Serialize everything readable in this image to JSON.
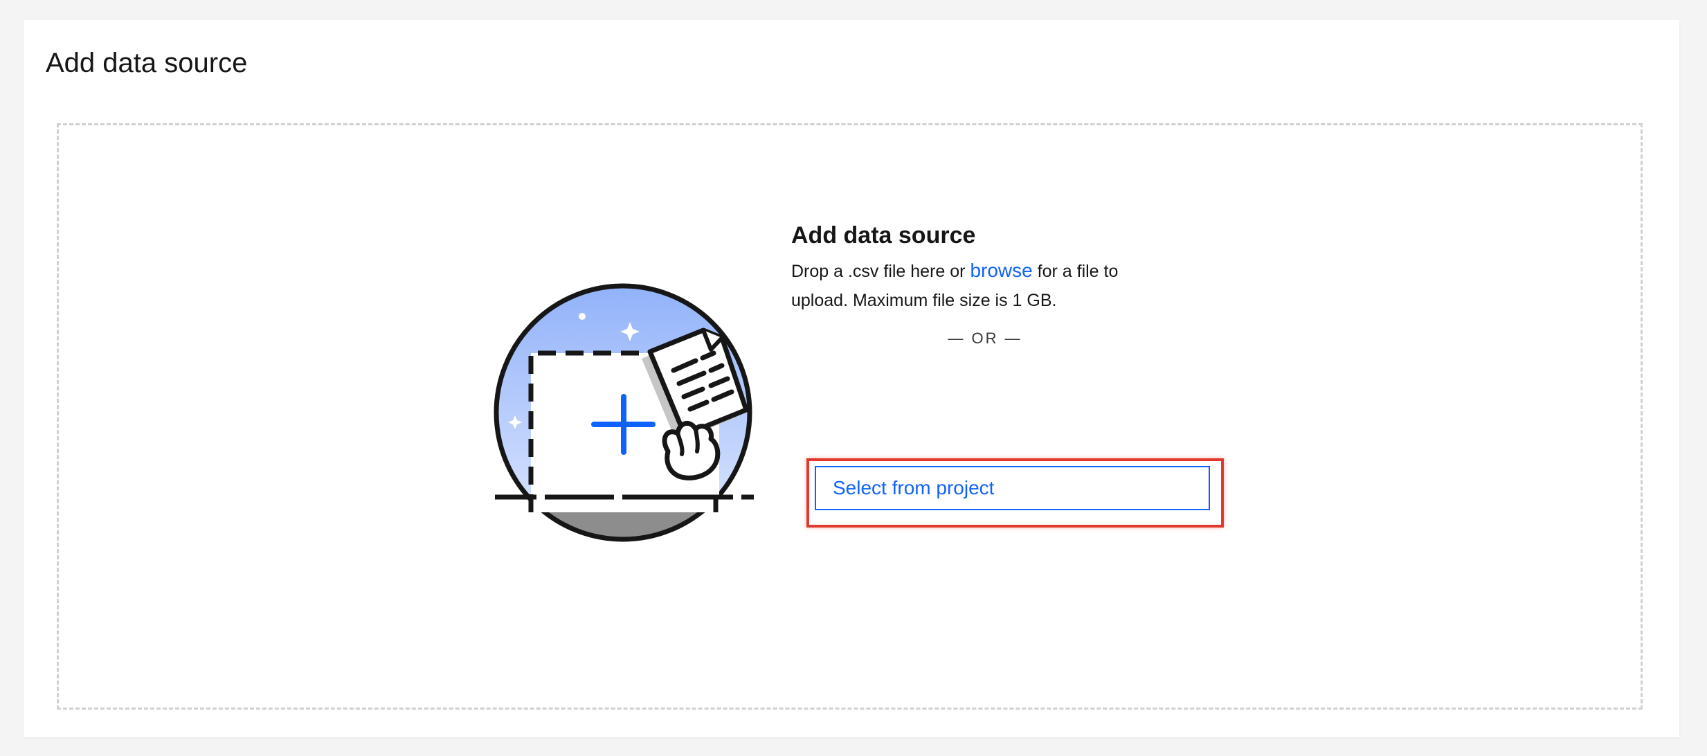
{
  "page": {
    "title": "Add data source"
  },
  "dropzone": {
    "heading": "Add data source",
    "desc_before": "Drop a .csv file here or ",
    "browse_label": "browse",
    "desc_after": " for a file to upload. Maximum file size is 1 GB.",
    "or_label": "— OR —",
    "select_button_label": "Select from project",
    "illustration_icon": "upload-file-illustration"
  },
  "colors": {
    "accent": "#0f62fe",
    "highlight": "#e1382f",
    "dashed_border": "#d0d0d0",
    "sky_top": "#8fb0f9",
    "sky_bottom": "#dbe6ff",
    "ground": "#8d8d8d"
  }
}
